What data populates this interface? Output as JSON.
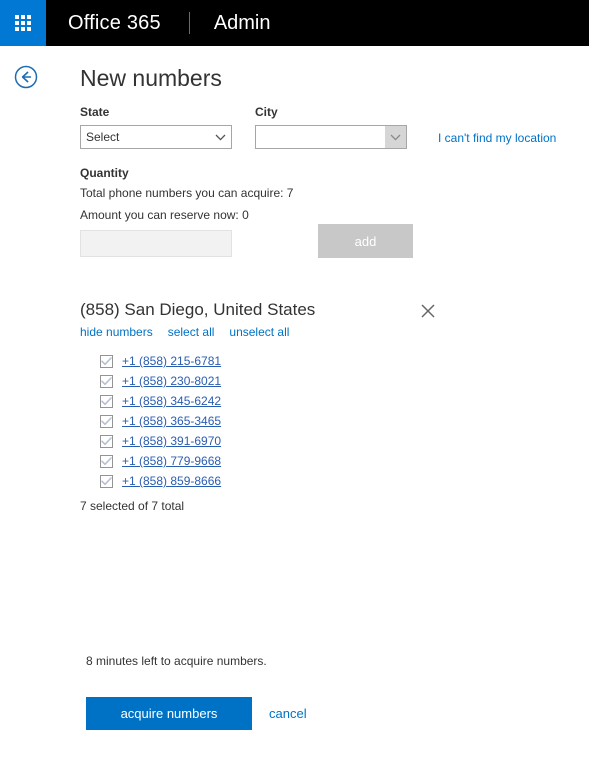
{
  "suite_header": {
    "waffle_icon": "app-launcher-waffle-icon",
    "brand": "Office 365",
    "app": "Admin"
  },
  "page": {
    "back_icon": "back-arrow-circle-icon",
    "title": "New numbers"
  },
  "form": {
    "state": {
      "label": "State",
      "value": "Select",
      "options": [
        "Select"
      ],
      "chevron_icon": "chevron-down-icon"
    },
    "city": {
      "label": "City",
      "value": "",
      "options": [
        ""
      ],
      "chevron_icon": "chevron-down-icon",
      "disabled": true
    },
    "cannot_find_location_link": "I can't find my location"
  },
  "quantity": {
    "title": "Quantity",
    "total_line": "Total phone numbers you can acquire: 7",
    "reserve_line": "Amount you can reserve now: 0",
    "input_value": "",
    "input_placeholder": "",
    "add_label": "add"
  },
  "area_group": {
    "title": "(858) San Diego, United States",
    "close_icon": "close-x-icon",
    "actions": [
      {
        "label": "hide numbers",
        "name": "hide-numbers-link"
      },
      {
        "label": "select all",
        "name": "select-all-link"
      },
      {
        "label": "unselect all",
        "name": "unselect-all-link"
      }
    ],
    "numbers": [
      {
        "number": "+1 (858) 215-6781",
        "checked": true
      },
      {
        "number": "+1 (858) 230-8021",
        "checked": true
      },
      {
        "number": "+1 (858) 345-6242",
        "checked": true
      },
      {
        "number": "+1 (858) 365-3465",
        "checked": true
      },
      {
        "number": "+1 (858) 391-6970",
        "checked": true
      },
      {
        "number": "+1 (858) 779-9668",
        "checked": true
      },
      {
        "number": "+1 (858) 859-8666",
        "checked": true
      }
    ],
    "count_text": "7 selected of 7 total"
  },
  "footer": {
    "timer_text": "8 minutes left to acquire numbers.",
    "acquire_label": "acquire numbers",
    "cancel_label": "cancel"
  },
  "colors": {
    "brand_blue": "#0078d4",
    "link_blue": "#0072c6",
    "number_link_blue": "#2a5db0",
    "header_black": "#000000",
    "disabled_gray": "#c8c8c8"
  }
}
